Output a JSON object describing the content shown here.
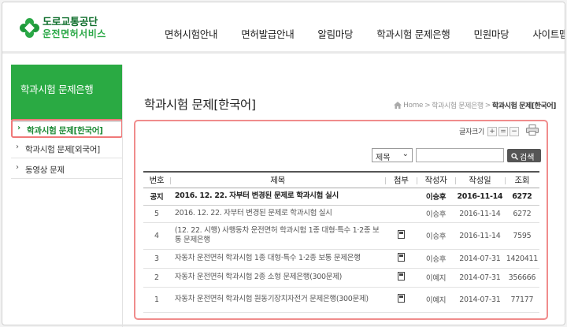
{
  "header": {
    "logo": {
      "line1": "도로교통공단",
      "line2": "운전면허서비스"
    },
    "nav": [
      "면허시험안내",
      "면허발급안내",
      "알림마당",
      "학과시험 문제은행",
      "민원마당",
      "사이트맵"
    ]
  },
  "sidebar": {
    "title": "학과시험 문제은행",
    "items": [
      {
        "label": "학과시험 문제[한국어]",
        "active": true
      },
      {
        "label": "학과시험 문제[외국어]",
        "active": false
      },
      {
        "label": "동영상 문제",
        "active": false
      }
    ]
  },
  "page": {
    "title": "학과시험 문제[한국어]",
    "breadcrumb": [
      "Home",
      "학과시험 문제은행",
      "학과시험 문제[한국어]"
    ]
  },
  "tools": {
    "font_size_label": "글자크기",
    "font_plus": "+",
    "font_reset": "=",
    "font_minus": "−"
  },
  "search": {
    "select_value": "제목",
    "input_value": "",
    "button_label": "검색"
  },
  "table": {
    "columns": [
      "번호",
      "제목",
      "첨부",
      "작성자",
      "작성일",
      "조회"
    ],
    "rows": [
      {
        "no": "공지",
        "title": "2016. 12. 22. 자부터 변경된 문제로 학과시험 실시",
        "attach": false,
        "author": "이승후",
        "date": "2016-11-14",
        "views": "6272",
        "notice": true
      },
      {
        "no": "5",
        "title": "2016. 12. 22. 자부터 변경된 문제로 학과시험 실시",
        "attach": false,
        "author": "이승후",
        "date": "2016-11-14",
        "views": "6272",
        "notice": false
      },
      {
        "no": "4",
        "title": "(12. 22. 시행) 사행동차 운전면허 학과시험 1종 대형·특수 1·2종 보통 문제은행",
        "attach": true,
        "author": "이승후",
        "date": "2016-11-14",
        "views": "7595",
        "notice": false
      },
      {
        "no": "3",
        "title": "자동차 운전면허 학과시험 1종 대형·특수 1·2종 보통 문제은행",
        "attach": true,
        "author": "이승후",
        "date": "2014-07-31",
        "views": "1420411",
        "notice": false
      },
      {
        "no": "2",
        "title": "자동차 운전면허 학과시험 2종 소형 문제은행(300문제)",
        "attach": true,
        "author": "이예지",
        "date": "2014-07-31",
        "views": "356666",
        "notice": false
      },
      {
        "no": "1",
        "title": "자동차 운전면허 학과시험 원동기장치자전거 문제은행(300문제)",
        "attach": true,
        "author": "이예지",
        "date": "2014-07-31",
        "views": "77177",
        "notice": false
      }
    ]
  },
  "colors": {
    "brand_green": "#2aaa43",
    "highlight_red": "#f08c8c"
  },
  "icons": [
    "logo-clover-icon",
    "home-icon",
    "print-icon",
    "search-icon",
    "attachment-icon",
    "chevron-down-icon",
    "arrow-right-icon"
  ]
}
